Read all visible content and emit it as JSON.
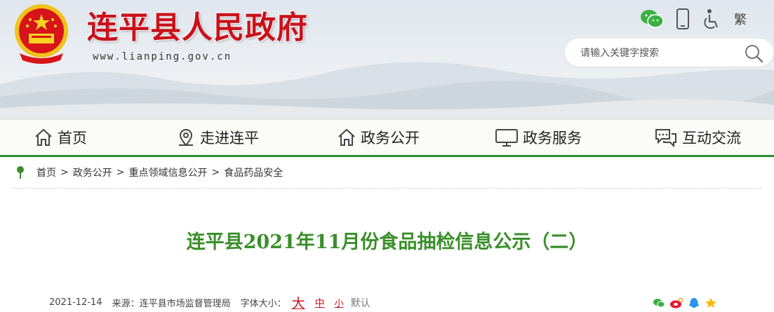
{
  "header": {
    "site_title": "连平县人民政府",
    "site_url": "www.lianping.gov.cn",
    "top_icons": [
      "wechat-icon",
      "mobile-icon",
      "accessibility-icon"
    ],
    "traditional_label": "繁",
    "search_placeholder": "请输入关键字搜索"
  },
  "nav": {
    "items": [
      {
        "label": "首页",
        "icon": "home-icon"
      },
      {
        "label": "走进连平",
        "icon": "location-pin-icon"
      },
      {
        "label": "政务公开",
        "icon": "home-icon"
      },
      {
        "label": "政务服务",
        "icon": "monitor-icon"
      },
      {
        "label": "互动交流",
        "icon": "chat-bubbles-icon"
      }
    ]
  },
  "breadcrumb": {
    "items": [
      "首页",
      "政务公开",
      "重点领域信息公开",
      "食品药品安全"
    ],
    "separator": ">"
  },
  "article": {
    "title": "连平县2021年11月份食品抽检信息公示（二）",
    "date": "2021-12-14",
    "source_label": "来源：连平县市场监督管理局",
    "font_size_label": "字体大小：",
    "font_sizes": [
      "大",
      "中",
      "小",
      "默认"
    ]
  },
  "share": [
    "wechat-icon",
    "weibo-icon",
    "qq-icon",
    "qzone-icon"
  ],
  "colors": {
    "brand_red": "#c8121b",
    "brand_green": "#2e8b2e",
    "title_green": "#3a8f2a"
  }
}
